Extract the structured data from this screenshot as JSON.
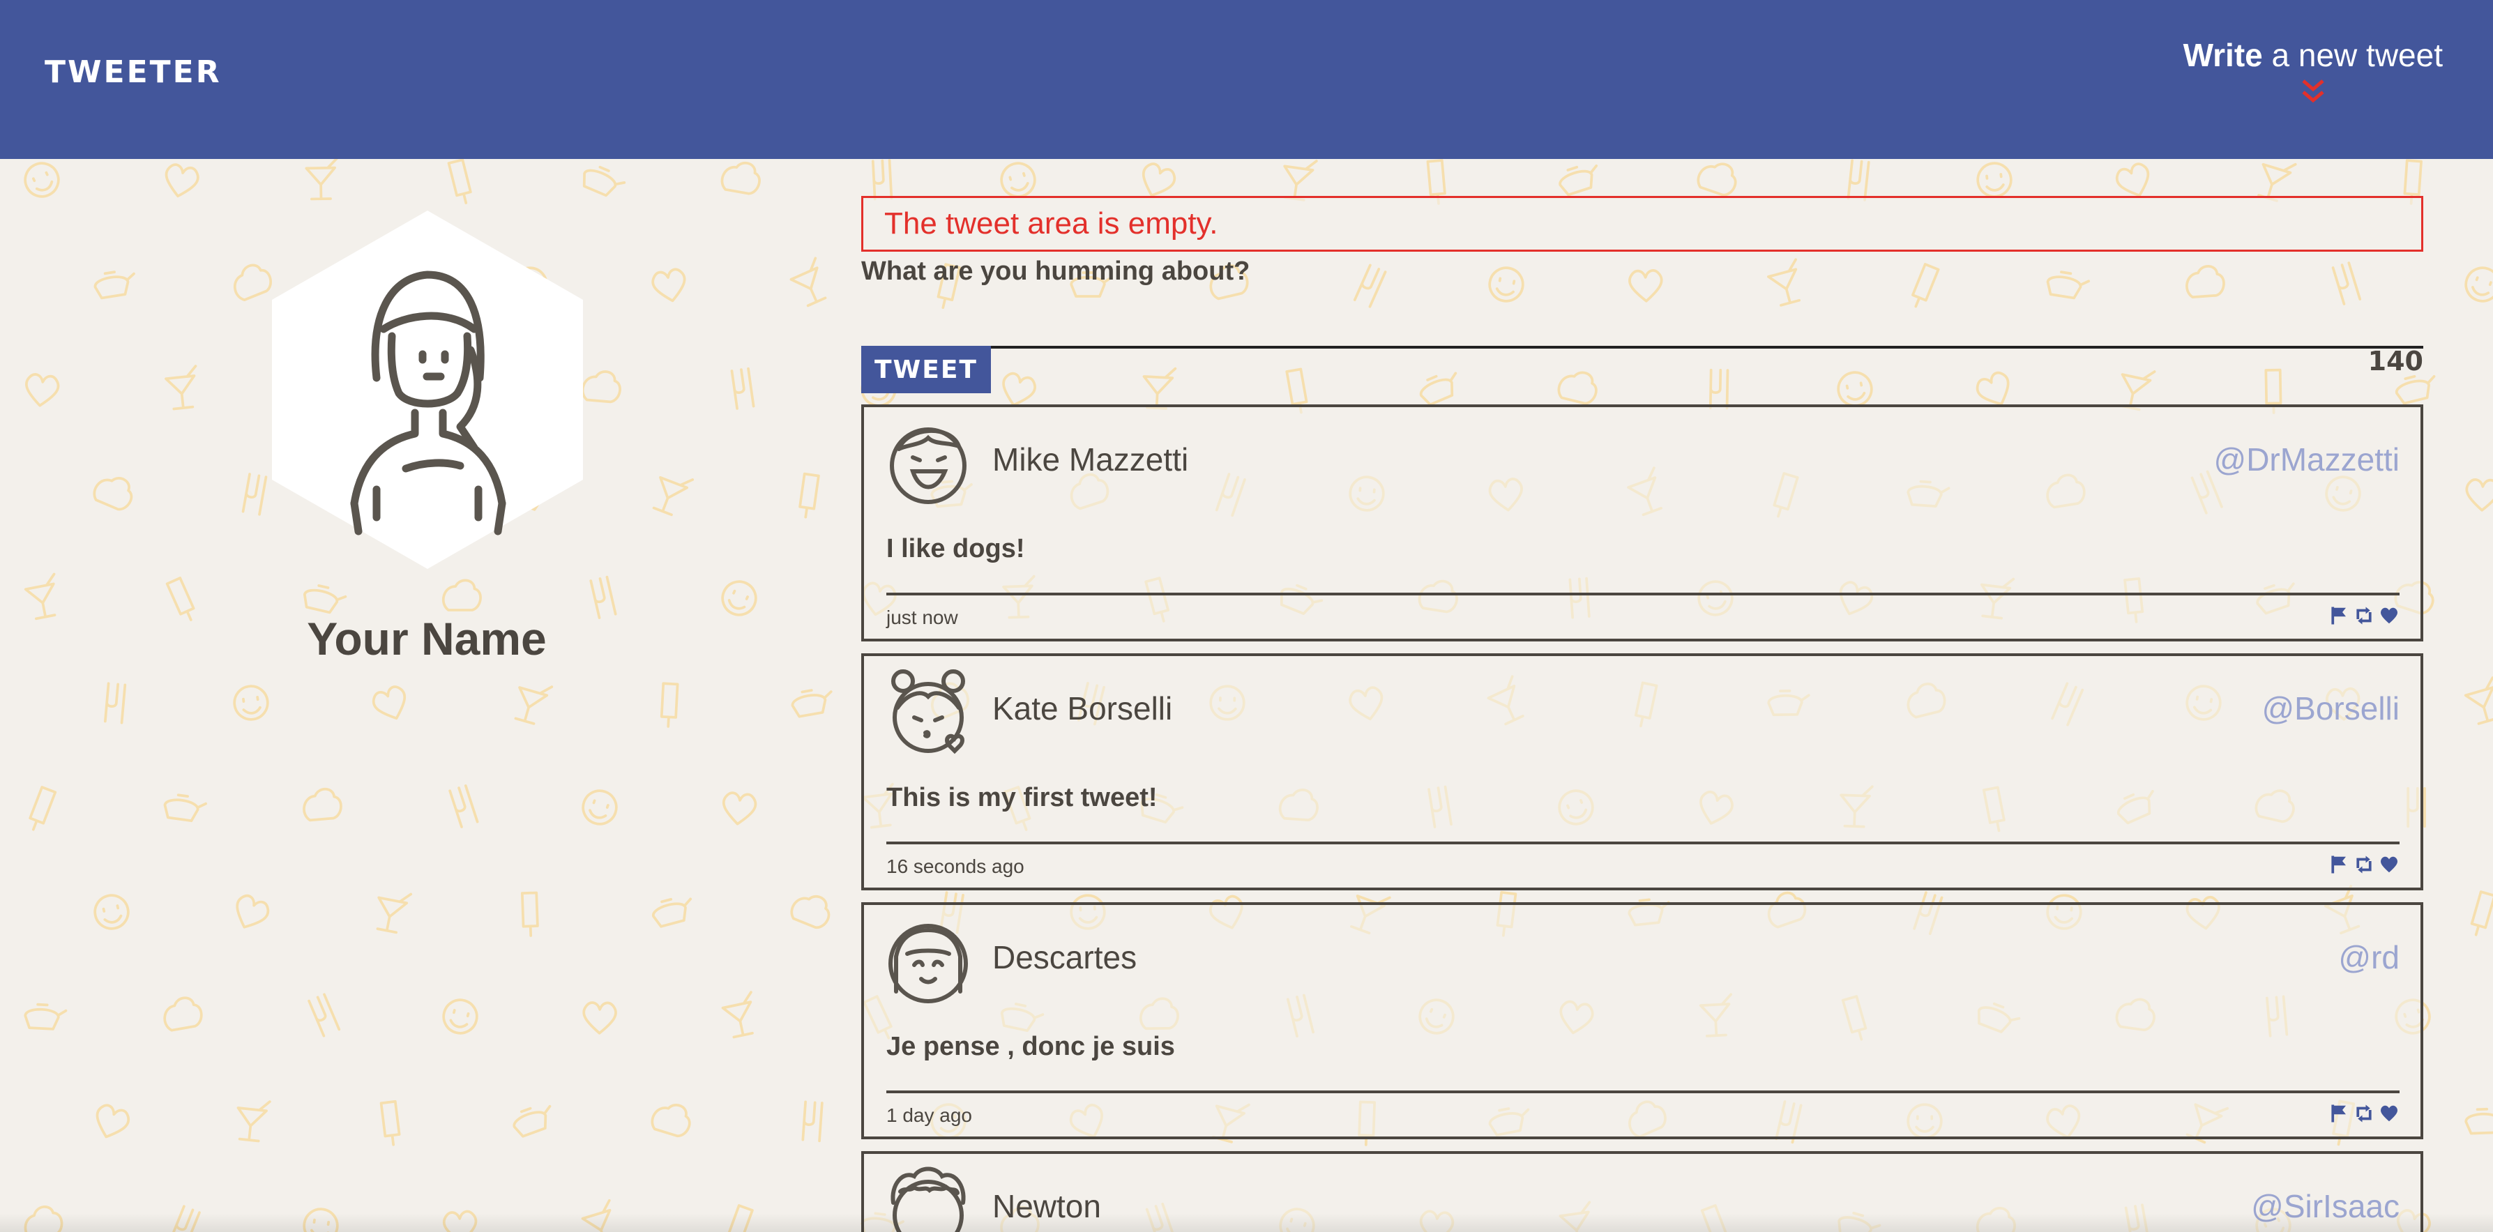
{
  "header": {
    "brand": "TWEETER",
    "compose_bold": "Write",
    "compose_rest": " a new tweet"
  },
  "profile": {
    "name": "Your Name"
  },
  "compose": {
    "error": "The tweet area is empty.",
    "label": "What are you humming about?",
    "textarea_value": "",
    "button": "TWEET",
    "counter": "140"
  },
  "tweets": [
    {
      "name": "Mike Mazzetti",
      "handle": "@DrMazzetti",
      "text": "I like dogs!",
      "time": "just now"
    },
    {
      "name": "Kate Borselli",
      "handle": "@Borselli",
      "text": "This is my first tweet!",
      "time": "16 seconds ago"
    },
    {
      "name": "Descartes",
      "handle": "@rd",
      "text": "Je pense , donc je suis",
      "time": "1 day ago"
    },
    {
      "name": "Newton",
      "handle": "@SirIsaac",
      "text": "",
      "time": ""
    }
  ],
  "colors": {
    "header_bg": "#43569b",
    "page_bg": "#f3f0eb",
    "error": "#e3302b",
    "handle": "#9ba5d0",
    "pattern": "#f6dfae"
  }
}
